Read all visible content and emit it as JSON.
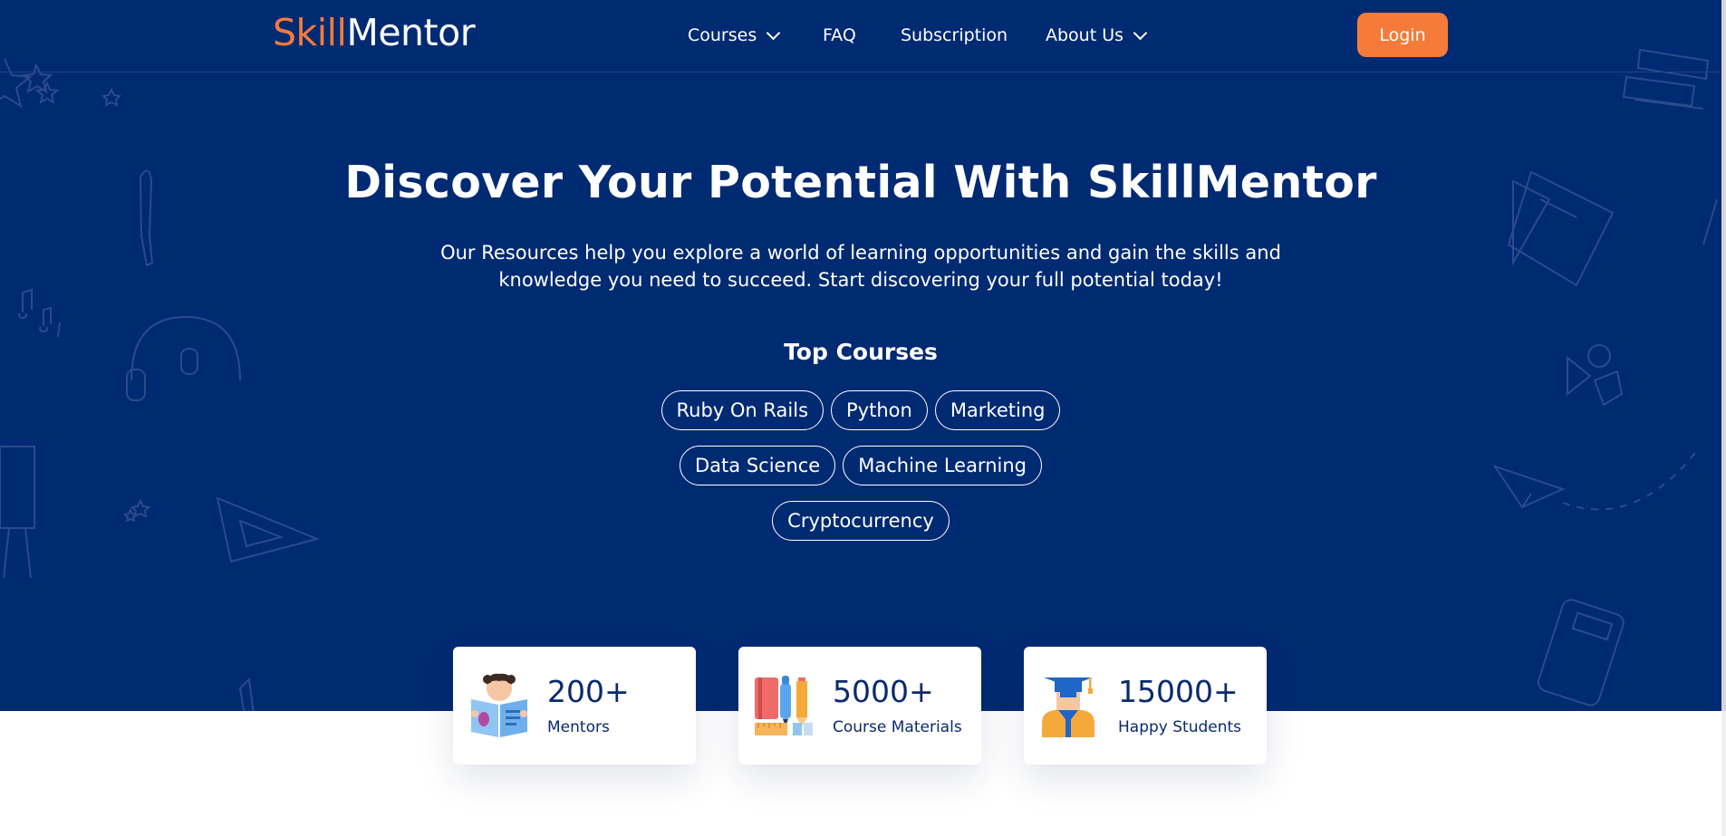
{
  "brand": {
    "part1": "Skill",
    "part2": "Mentor"
  },
  "nav": {
    "items": [
      {
        "label": "Courses"
      },
      {
        "label": "FAQ"
      },
      {
        "label": "Subscription"
      },
      {
        "label": "About Us"
      }
    ],
    "login_label": "Login"
  },
  "hero": {
    "title": "Discover Your Potential With SkillMentor",
    "subtitle_line1": "Our Resources help you explore a world of learning opportunities and gain the skills and",
    "subtitle_line2": "knowledge you need to succeed. Start discovering your full potential today!"
  },
  "top_courses": {
    "heading": "Top Courses",
    "rows": [
      [
        "Ruby On Rails",
        "Python",
        "Marketing"
      ],
      [
        "Data Science",
        "Machine Learning"
      ],
      [
        "Cryptocurrency"
      ]
    ]
  },
  "stats": [
    {
      "value": "200+",
      "label": "Mentors",
      "icon": "reading-mentor-icon"
    },
    {
      "value": "5000+",
      "label": "Course Materials",
      "icon": "books-stationery-icon"
    },
    {
      "value": "15000+",
      "label": "Happy Students",
      "icon": "graduate-student-icon"
    }
  ],
  "colors": {
    "primary": "#002a72",
    "accent": "#f47b3a",
    "text_light": "#ffffff",
    "text_dark": "#0a2a6e"
  }
}
